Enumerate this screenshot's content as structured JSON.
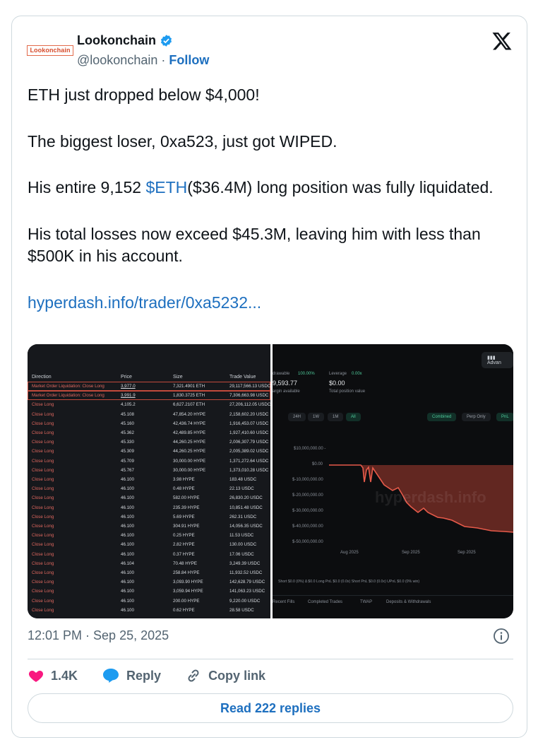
{
  "author": {
    "avatar_text": "Lookonchain",
    "name": "Lookonchain",
    "handle": "@lookonchain",
    "separator": " · ",
    "follow_label": "Follow"
  },
  "tweet": {
    "p1": "ETH just dropped below $4,000!",
    "p2": "The biggest loser, 0xa523, just got WIPED.",
    "p3_before": "His entire 9,152 ",
    "p3_cashtag": "$ETH",
    "p3_after": "($36.4M) long position was fully liquidated.",
    "p4": "His total losses now exceed $45.3M, leaving him with less than $500K in his account.",
    "link": "hyperdash.info/trader/0xa5232..."
  },
  "media": {
    "table": {
      "headers": [
        "Direction",
        "Price",
        "Size",
        "Trade Value"
      ],
      "rows": [
        [
          "Market Order Liquidation: Close Long",
          "3,977.0",
          "7,321.4901 ETH",
          "29,117,566.13 USDC"
        ],
        [
          "Market Order Liquidation: Close Long",
          "3,991.9",
          "1,830.3725 ETH",
          "7,306,663.98 USDC"
        ],
        [
          "Close Long",
          "4,105.2",
          "6,627.2107 ETH",
          "27,206,112.05 USDC"
        ],
        [
          "Close Long",
          "45.108",
          "47,854.20 HYPE",
          "2,158,602.20 USDC"
        ],
        [
          "Close Long",
          "45.160",
          "42,436.74 HYPE",
          "1,916,453.07 USDC"
        ],
        [
          "Close Long",
          "45.362",
          "42,489.85 HYPE",
          "1,927,410.60 USDC"
        ],
        [
          "Close Long",
          "45.330",
          "44,260.25 HYPE",
          "2,006,307.79 USDC"
        ],
        [
          "Close Long",
          "45.309",
          "44,260.25 HYPE",
          "2,005,389.02 USDC"
        ],
        [
          "Close Long",
          "45.709",
          "30,000.00 HYPE",
          "1,371,272.64 USDC"
        ],
        [
          "Close Long",
          "45.767",
          "30,000.00 HYPE",
          "1,373,010.28 USDC"
        ],
        [
          "Close Long",
          "46.100",
          "3.98 HYPE",
          "183.48 USDC"
        ],
        [
          "Close Long",
          "46.100",
          "0.48 HYPE",
          "22.13 USDC"
        ],
        [
          "Close Long",
          "46.100",
          "582.00 HYPE",
          "26,830.20 USDC"
        ],
        [
          "Close Long",
          "46.100",
          "235.39 HYPE",
          "10,851.48 USDC"
        ],
        [
          "Close Long",
          "46.100",
          "5.69 HYPE",
          "262.31 USDC"
        ],
        [
          "Close Long",
          "46.100",
          "304.91 HYPE",
          "14,056.35 USDC"
        ],
        [
          "Close Long",
          "46.100",
          "0.25 HYPE",
          "11.53 USDC"
        ],
        [
          "Close Long",
          "46.100",
          "2.82 HYPE",
          "130.00 USDC"
        ],
        [
          "Close Long",
          "46.100",
          "0.37 HYPE",
          "17.06 USDC"
        ],
        [
          "Close Long",
          "46.104",
          "70.48 HYPE",
          "3,249.39 USDC"
        ],
        [
          "Close Long",
          "46.100",
          "258.84 HYPE",
          "11,932.52 USDC"
        ],
        [
          "Close Long",
          "46.100",
          "3,093.90 HYPE",
          "142,628.79 USDC"
        ],
        [
          "Close Long",
          "46.100",
          "3,059.94 HYPE",
          "141,063.23 USDC"
        ],
        [
          "Close Long",
          "46.100",
          "200.00 HYPE",
          "9,220.00 USDC"
        ],
        [
          "Close Long",
          "46.100",
          "0.62 HYPE",
          "28.58 USDC"
        ]
      ]
    },
    "right": {
      "advanced_label": "Advan",
      "withdrawable_label": "drawable",
      "withdrawable_pct": "100.00%",
      "withdrawable_value": "9,593.77",
      "margin_label": "argin available",
      "leverage_label": "Leverage",
      "leverage_value": "0.00x",
      "position_value": "$0.00",
      "position_label": "Total position value",
      "range_tabs": [
        "24H",
        "1W",
        "1M",
        "All"
      ],
      "mode_tabs": [
        "Combined",
        "Perp Only",
        "PnL"
      ],
      "y_ticks": [
        "$10,000,000.00 -",
        "$0.00",
        "$-10,000,000.00",
        "$-20,000,000.00",
        "$-30,000,000.00",
        "$-40,000,000.00",
        "$-50,000,000.00"
      ],
      "x_ticks": [
        "Aug 2025",
        "Sep 2025",
        "Sep 2025"
      ],
      "watermark": "hyperdash.info",
      "footer_stats": "Short $0.0 (0%)   Δ $0.0   Long PnL $0.0 (0.0x)   Short PnL $0.0 (0.0x)   UPnL $0.0 (0% win)",
      "bottom_tabs": [
        "Recent Fills",
        "Completed Trades",
        "TWAP",
        "Deposits & Withdrawals"
      ]
    }
  },
  "timestamp": "12:01 PM · Sep 25, 2025",
  "actions": {
    "like_count": "1.4K",
    "reply_label": "Reply",
    "copy_label": "Copy link"
  },
  "read_replies": "Read 222 replies",
  "colors": {
    "link": "#1d6fbf",
    "like": "#f91880",
    "reply": "#1d9bf0",
    "close_long": "#e0685f",
    "chart_fill": "#6b2a23",
    "chart_line": "#e65a4a"
  }
}
